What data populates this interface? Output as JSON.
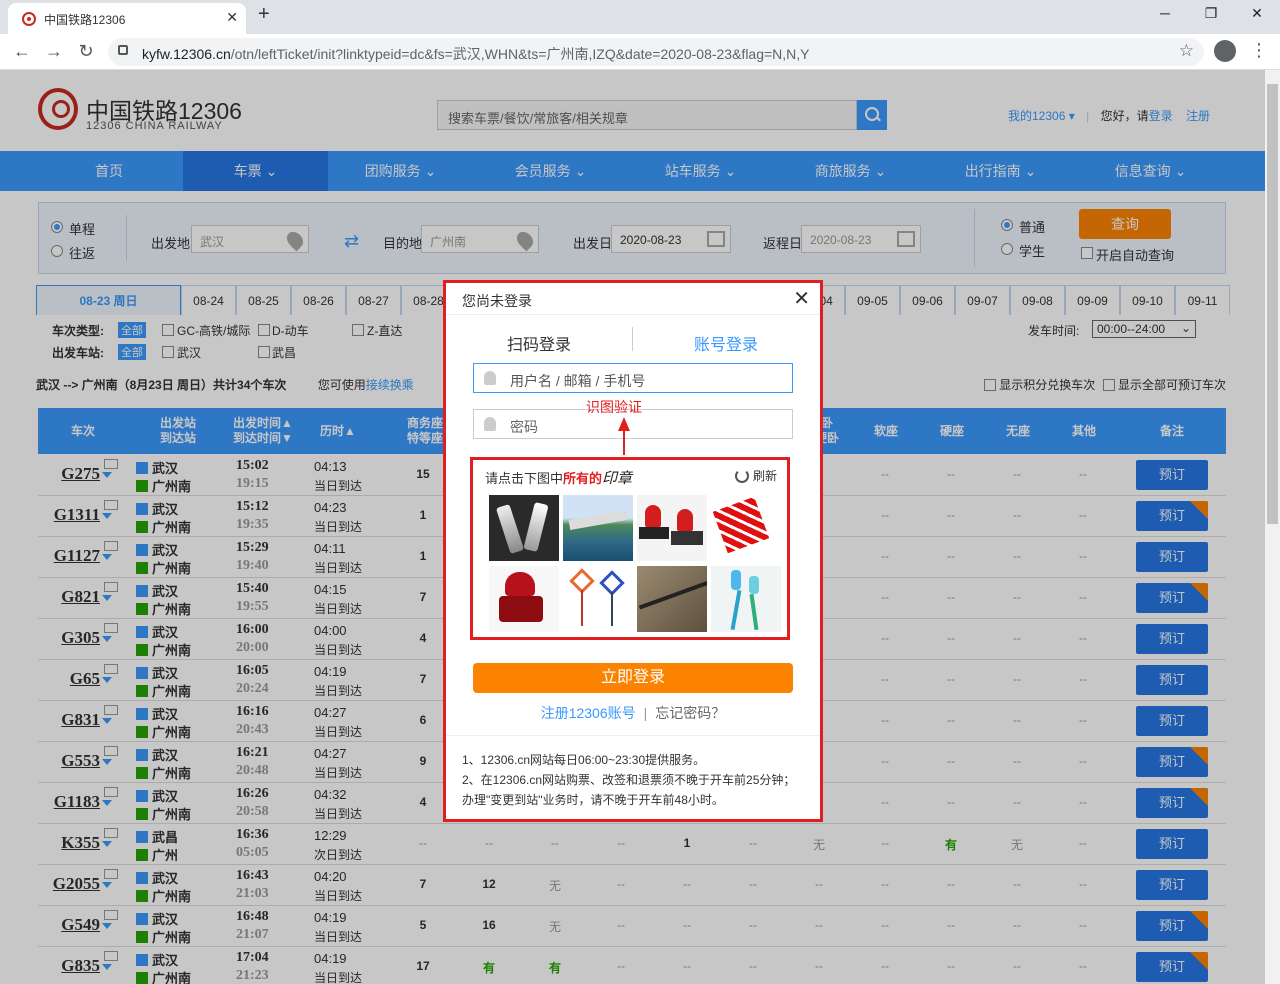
{
  "browser": {
    "tab_title": "中国铁路12306",
    "tab_close": "✕",
    "new_tab": "+",
    "url_host": "kyfw.12306.cn",
    "url_path": "/otn/leftTicket/init?linktypeid=dc&fs=武汉,WHN&ts=广州南,IZQ&date=2020-08-23&flag=N,N,Y",
    "controls": {
      "minimize": "─",
      "restore": "❐",
      "close": "✕"
    },
    "nav": {
      "back": "←",
      "forward": "→",
      "reload": "↻",
      "star": "☆",
      "menu": "⋮"
    }
  },
  "site": {
    "logo_cn": "中国铁路12306",
    "logo_en": "12306 CHINA RAILWAY",
    "search_placeholder": "搜索车票/餐饮/常旅客/相关规章",
    "my_12306": "我的12306",
    "greeting": "您好，请",
    "login": "登录",
    "register": "注册"
  },
  "nav": [
    "首页",
    "车票",
    "团购服务",
    "会员服务",
    "站车服务",
    "商旅服务",
    "出行指南",
    "信息查询"
  ],
  "query": {
    "one_way": "单程",
    "round_trip": "往返",
    "from_label": "出发地",
    "from_value": "武汉",
    "to_label": "目的地",
    "to_value": "广州南",
    "depart_label": "出发日",
    "depart_value": "2020-08-23",
    "return_label": "返程日",
    "return_value": "2020-08-23",
    "normal": "普通",
    "student": "学生",
    "search_btn": "查询",
    "auto_query": "开启自动查询"
  },
  "dates": [
    "08-23 周日",
    "08-24",
    "08-25",
    "08-26",
    "08-27",
    "08-28",
    "09-04",
    "09-05",
    "09-06",
    "09-07",
    "09-08",
    "09-09",
    "09-10",
    "09-11"
  ],
  "filters": {
    "type_label": "车次类型:",
    "station_label": "出发车站:",
    "all": "全部",
    "types": [
      "GC-高铁/城际",
      "D-动车",
      "Z-直达"
    ],
    "stations": [
      "武汉",
      "武昌"
    ],
    "time_label": "发车时间:",
    "time_value": "00:00--24:00"
  },
  "result": {
    "summary": "武汉 --> 广州南（8月23日  周日）共计34个车次",
    "hint": "您可使用",
    "hint_link": "接续换乘",
    "show_points": "显示积分兑换车次",
    "show_all": "显示全部可预订车次"
  },
  "table_headers": {
    "train": "车次",
    "station": "出发站\n到达站",
    "time": "出发时间▲\n到达时间▼",
    "duration": "历时▲",
    "business": "商务座\n特等座",
    "hidden_col": "卧\n硬卧",
    "soft_seat": "软座",
    "hard_seat": "硬座",
    "no_seat": "无座",
    "other": "其他",
    "remark": "备注"
  },
  "trains": [
    {
      "no": "G275",
      "from": "武汉",
      "to": "广州南",
      "dep": "15:02",
      "arr": "19:15",
      "dur": "04:13",
      "day": "当日到达",
      "c1": "15",
      "c2": "--",
      "c3": "--",
      "c4": "--",
      "c5": "--",
      "c6": "--",
      "c7": "--",
      "c8": "--",
      "c9": "--",
      "c10": "--",
      "c11": "--",
      "c12": "--",
      "corner": false
    },
    {
      "no": "G1311",
      "from": "武汉",
      "to": "广州南",
      "dep": "15:12",
      "arr": "19:35",
      "dur": "04:23",
      "day": "当日到达",
      "c1": "1",
      "c2": "--",
      "c3": "--",
      "c4": "--",
      "c5": "--",
      "c6": "--",
      "c7": "--",
      "c8": "--",
      "c9": "--",
      "c10": "--",
      "c11": "--",
      "c12": "--",
      "corner": true
    },
    {
      "no": "G1127",
      "from": "武汉",
      "to": "广州南",
      "dep": "15:29",
      "arr": "19:40",
      "dur": "04:11",
      "day": "当日到达",
      "c1": "1",
      "c2": "--",
      "c3": "--",
      "c4": "--",
      "c5": "--",
      "c6": "--",
      "c7": "--",
      "c8": "--",
      "c9": "--",
      "c10": "--",
      "c11": "--",
      "c12": "--",
      "corner": false
    },
    {
      "no": "G821",
      "from": "武汉",
      "to": "广州南",
      "dep": "15:40",
      "arr": "19:55",
      "dur": "04:15",
      "day": "当日到达",
      "c1": "7",
      "c2": "--",
      "c3": "--",
      "c4": "--",
      "c5": "--",
      "c6": "--",
      "c7": "--",
      "c8": "--",
      "c9": "--",
      "c10": "--",
      "c11": "--",
      "c12": "--",
      "corner": true
    },
    {
      "no": "G305",
      "from": "武汉",
      "to": "广州南",
      "dep": "16:00",
      "arr": "20:00",
      "dur": "04:00",
      "day": "当日到达",
      "c1": "4",
      "c2": "--",
      "c3": "--",
      "c4": "--",
      "c5": "--",
      "c6": "--",
      "c7": "--",
      "c8": "--",
      "c9": "--",
      "c10": "--",
      "c11": "--",
      "c12": "--",
      "corner": false
    },
    {
      "no": "G65",
      "from": "武汉",
      "to": "广州南",
      "dep": "16:05",
      "arr": "20:24",
      "dur": "04:19",
      "day": "当日到达",
      "c1": "7",
      "c2": "--",
      "c3": "--",
      "c4": "--",
      "c5": "--",
      "c6": "--",
      "c7": "--",
      "c8": "--",
      "c9": "--",
      "c10": "--",
      "c11": "--",
      "c12": "--",
      "corner": false
    },
    {
      "no": "G831",
      "from": "武汉",
      "to": "广州南",
      "dep": "16:16",
      "arr": "20:43",
      "dur": "04:27",
      "day": "当日到达",
      "c1": "6",
      "c2": "--",
      "c3": "--",
      "c4": "--",
      "c5": "--",
      "c6": "--",
      "c7": "--",
      "c8": "--",
      "c9": "--",
      "c10": "--",
      "c11": "--",
      "c12": "--",
      "corner": false
    },
    {
      "no": "G553",
      "from": "武汉",
      "to": "广州南",
      "dep": "16:21",
      "arr": "20:48",
      "dur": "04:27",
      "day": "当日到达",
      "c1": "9",
      "c2": "--",
      "c3": "--",
      "c4": "--",
      "c5": "--",
      "c6": "--",
      "c7": "--",
      "c8": "--",
      "c9": "--",
      "c10": "--",
      "c11": "--",
      "c12": "--",
      "corner": true
    },
    {
      "no": "G1183",
      "from": "武汉",
      "to": "广州南",
      "dep": "16:26",
      "arr": "20:58",
      "dur": "04:32",
      "day": "当日到达",
      "c1": "4",
      "c2": "--",
      "c3": "--",
      "c4": "--",
      "c5": "--",
      "c6": "--",
      "c7": "--",
      "c8": "--",
      "c9": "--",
      "c10": "--",
      "c11": "--",
      "c12": "--",
      "corner": true
    },
    {
      "no": "K355",
      "from": "武昌",
      "to": "广州",
      "dep": "16:36",
      "arr": "05:05",
      "dur": "12:29",
      "day": "次日到达",
      "c1": "--",
      "c2": "--",
      "c3": "--",
      "c4": "--",
      "c5": "1",
      "c6": "--",
      "c7": "无",
      "c8": "--",
      "c9": "有",
      "c10": "无",
      "c11": "--",
      "c12": "--",
      "corner": false
    },
    {
      "no": "G2055",
      "from": "武汉",
      "to": "广州南",
      "dep": "16:43",
      "arr": "21:03",
      "dur": "04:20",
      "day": "当日到达",
      "c1": "7",
      "c2": "12",
      "c3": "无",
      "c4": "--",
      "c5": "--",
      "c6": "--",
      "c7": "--",
      "c8": "--",
      "c9": "--",
      "c10": "--",
      "c11": "--",
      "c12": "--",
      "corner": false
    },
    {
      "no": "G549",
      "from": "武汉",
      "to": "广州南",
      "dep": "16:48",
      "arr": "21:07",
      "dur": "04:19",
      "day": "当日到达",
      "c1": "5",
      "c2": "16",
      "c3": "无",
      "c4": "--",
      "c5": "--",
      "c6": "--",
      "c7": "--",
      "c8": "--",
      "c9": "--",
      "c10": "--",
      "c11": "--",
      "c12": "--",
      "corner": true
    },
    {
      "no": "G835",
      "from": "武汉",
      "to": "广州南",
      "dep": "17:04",
      "arr": "21:23",
      "dur": "04:19",
      "day": "当日到达",
      "c1": "17",
      "c2": "有",
      "c3": "有",
      "c4": "--",
      "c5": "--",
      "c6": "--",
      "c7": "--",
      "c8": "--",
      "c9": "--",
      "c10": "--",
      "c11": "--",
      "c12": "--",
      "corner": true
    }
  ],
  "book_label": "预订",
  "login_dialog": {
    "title": "您尚未登录",
    "close": "✕",
    "tab_qr": "扫码登录",
    "tab_account": "账号登录",
    "username_placeholder": "用户名 / 邮箱 / 手机号",
    "password_placeholder": "密码",
    "annotation": "识图验证",
    "captcha_prompt_a": "请点击下图中",
    "captcha_prompt_b": "所有的",
    "captcha_prompt_c": "印章",
    "refresh": "刷新",
    "captcha_images": [
      "glass-cups",
      "seaside-city",
      "rubber-stamps",
      "red-firecrackers",
      "red-stamp",
      "paper-cut-decorations",
      "metal-rod",
      "toothbrush"
    ],
    "login_btn": "立即登录",
    "register_link": "注册12306账号",
    "separator": "|",
    "forgot": "忘记密码？",
    "note1": "1、12306.cn网站每日06:00~23:30提供服务。",
    "note2": "2、在12306.cn网站购票、改签和退票须不晚于开车前25分钟；办理\"变更到站\"业务时，请不晚于开车前48小时。"
  },
  "colors": {
    "brand_blue": "#3b99fc",
    "nav_active": "#2676e3",
    "orange": "#fc8302",
    "brand_red": "#c72a1f",
    "annotation_red": "#e02020",
    "available_green": "#26a306"
  }
}
